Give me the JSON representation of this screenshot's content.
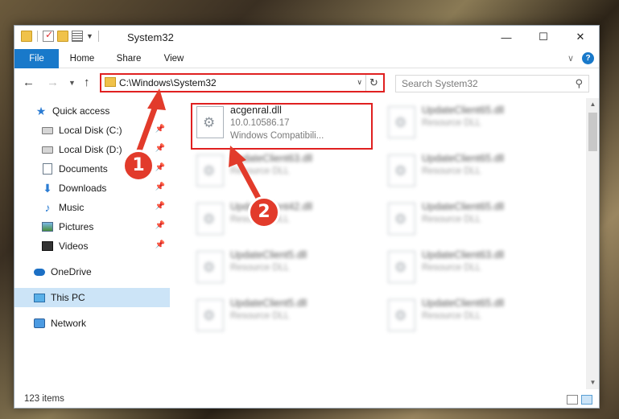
{
  "window": {
    "title": "System32",
    "controls": {
      "minimize": "—",
      "maximize": "☐",
      "close": "✕"
    }
  },
  "ribbon": {
    "tabs": {
      "file": "File",
      "home": "Home",
      "share": "Share",
      "view": "View"
    },
    "help": "?"
  },
  "nav": {
    "address": "C:\\Windows\\System32",
    "search_placeholder": "Search System32"
  },
  "sidebar": {
    "items": [
      {
        "label": "Quick access",
        "icon": "star-icon"
      },
      {
        "label": "Local Disk (C:)",
        "icon": "disk-icon"
      },
      {
        "label": "Local Disk (D:)",
        "icon": "disk-icon"
      },
      {
        "label": "Documents",
        "icon": "document-icon"
      },
      {
        "label": "Downloads",
        "icon": "download-icon"
      },
      {
        "label": "Music",
        "icon": "music-icon"
      },
      {
        "label": "Pictures",
        "icon": "pictures-icon"
      },
      {
        "label": "Videos",
        "icon": "videos-icon"
      },
      {
        "label": "OneDrive",
        "icon": "cloud-icon"
      },
      {
        "label": "This PC",
        "icon": "pc-icon"
      },
      {
        "label": "Network",
        "icon": "network-icon"
      }
    ]
  },
  "files": {
    "highlighted": {
      "name": "acgenral.dll",
      "version": "10.0.10586.17",
      "description": "Windows Compatibili..."
    },
    "blurred": [
      {
        "name": "UpdateClient65.dll",
        "type": "Resource DLL"
      },
      {
        "name": "UpdateClient63.dll",
        "type": "Resource DLL"
      },
      {
        "name": "UpdateClient65.dll",
        "type": "Resource DLL"
      },
      {
        "name": "UpdateClient42.dll",
        "type": "Resource DLL"
      },
      {
        "name": "UpdateClient65.dll",
        "type": "Resource DLL"
      },
      {
        "name": "UpdateClient5.dll",
        "type": "Resource DLL"
      },
      {
        "name": "UpdateClient63.dll",
        "type": "Resource DLL"
      },
      {
        "name": "UpdateClient5.dll",
        "type": "Resource DLL"
      },
      {
        "name": "UpdateClient65.dll",
        "type": "Resource DLL"
      }
    ]
  },
  "status": {
    "item_count": "123 items"
  },
  "annotations": {
    "step1": "1",
    "step2": "2",
    "color": "#e23b2b"
  }
}
